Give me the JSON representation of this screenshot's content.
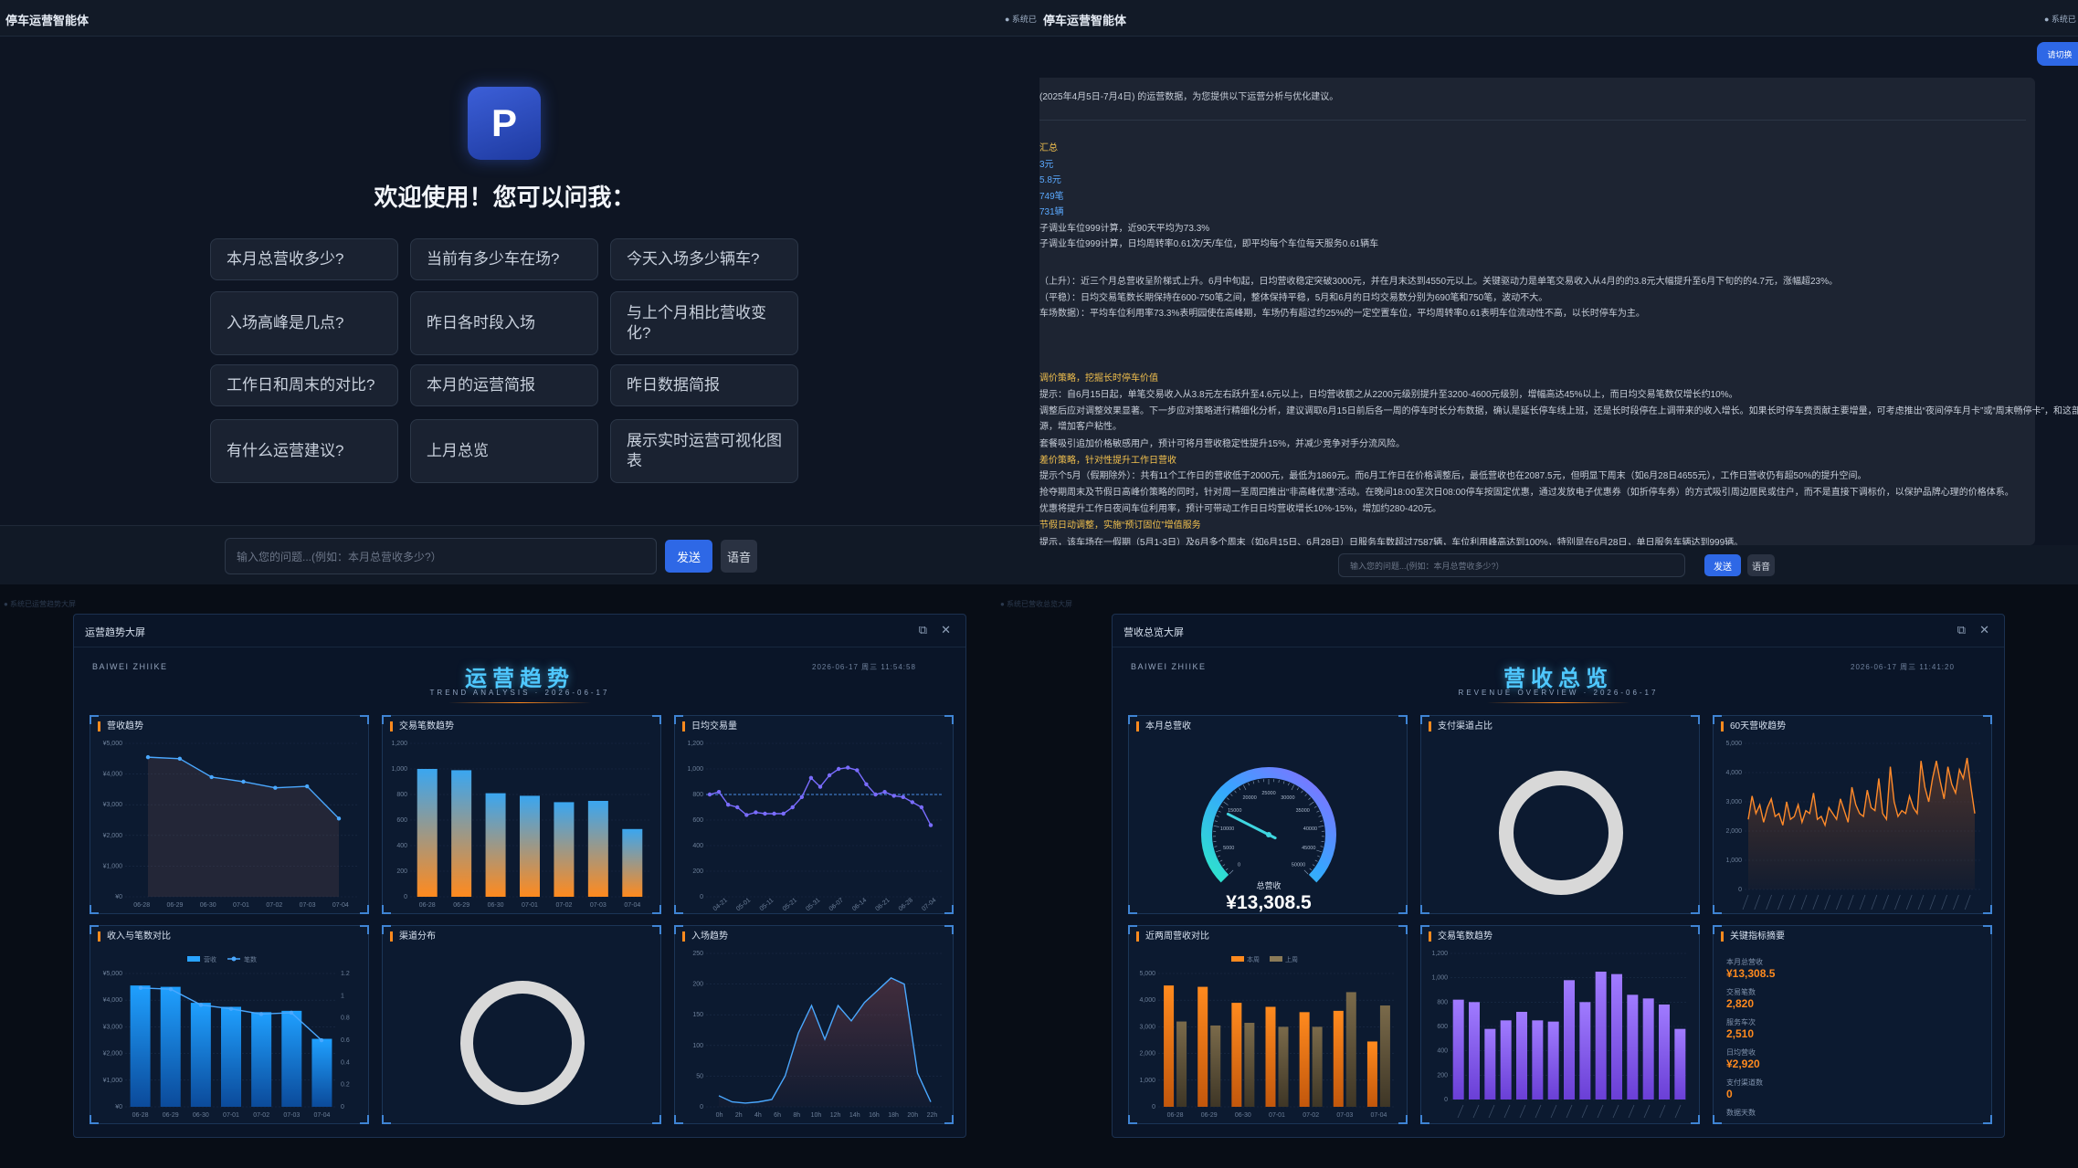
{
  "topbar": {
    "left_title": "停车运营智能体",
    "center_prefix": "● 系统已",
    "center_title": "停车运营智能体",
    "right_prefix": "● 系统已"
  },
  "float_button": "请切换",
  "assistant": {
    "welcome": "欢迎使用！您可以问我：",
    "suggestions": [
      "本月总营收多少?",
      "当前有多少车在场?",
      "今天入场多少辆车?",
      "入场高峰是几点?",
      "昨日各时段入场",
      "与上个月相比营收变化?",
      "工作日和周末的对比?",
      "本月的运营简报",
      "昨日数据简报",
      "有什么运营建议?",
      "上月总览",
      "展示实时运营可视化图表"
    ],
    "input_placeholder": "输入您的问题...(例如：本月总营收多少?）",
    "send_label": "发送",
    "voice_label": "语音"
  },
  "report": {
    "lines": [
      {
        "text": "(2025年4月5日-7月4日) 的运营数据，为您提供以下运营分析与优化建议。",
        "color": "#c6cdd8"
      },
      {
        "text": "汇总",
        "color": "#f2c14e"
      },
      {
        "text": "3元",
        "color": "#5aa9ff"
      },
      {
        "text": "5.8元",
        "color": "#5aa9ff"
      },
      {
        "text": "749笔",
        "color": "#5aa9ff"
      },
      {
        "text": "731辆",
        "color": "#5aa9ff"
      },
      {
        "text": "子调业车位999计算，近90天平均为73.3%",
        "color": "#c6cdd8"
      },
      {
        "text": "子调业车位999计算，日均周转率0.61次/天/车位，即平均每个车位每天服务0.61辆车",
        "color": "#c6cdd8"
      },
      {
        "text": "（上升）：近三个月总营收呈阶梯式上升。6月中旬起，日均营收稳定突破3000元，并在月末达到4550元以上。关键驱动力是单笔交易收入从4月的的3.8元大幅提升至6月下旬的的4.7元，涨幅超23%。",
        "color": "#c6cdd8"
      },
      {
        "text": "（平稳）：日均交易笔数长期保持在600-750笔之间，整体保持平稳，5月和6月的日均交易数分别为690笔和750笔，波动不大。",
        "color": "#c6cdd8"
      },
      {
        "text": "车场数据）：平均车位利用率73.3%表明园使在高峰期，车场仍有超过约25%的一定空置车位，平均周转率0.61表明车位流动性不高，以长时停车为主。",
        "color": "#c6cdd8"
      },
      {
        "text": "调价策略，挖掘长时停车价值",
        "color": "#f2c14e"
      },
      {
        "text": "提示：自6月15日起，单笔交易收入从3.8元左右跃升至4.6元以上，日均营收额之从2200元级别提升至3200-4600元级别，增幅高达45%以上，而日均交易笔数仅增长约10%。",
        "color": "#c6cdd8"
      },
      {
        "text": "调整后应对调整效果显著。下一步应对策略进行精细化分析，建议调取6月15日前后各一周的停车时长分布数据，确认是延长停车线上班，还是长时段停在上调带来的收入增长。如果长时停车费贡献主要增量，可考虑推出“夜间停车月卡”或“周末畅停卡”，和这部分新增的长时客",
        "color": "#c6cdd8"
      },
      {
        "text": "源，增加客户粘性。",
        "color": "#c6cdd8"
      },
      {
        "text": "套餐吸引追加价格敏感用户，预计可将月营收稳定性提升15%，并减少竞争对手分流风险。",
        "color": "#c6cdd8"
      },
      {
        "text": "差价策略，针对性提升工作日营收",
        "color": "#f2c14e"
      },
      {
        "text": "提示个5月（假期除外）：共有11个工作日的营收低于2000元，最低为1869元。而6月工作日在价格调整后，最低营收也在2087.5元，但明显下周末（如6月28日4655元），工作日营收仍有超50%的提升空间。",
        "color": "#c6cdd8"
      },
      {
        "text": "抢夺期周末及节假日高峰价策略的同时，针对周一至周四推出“非高峰优惠”活动。在晚间18:00至次日08:00停车按固定优惠，通过发放电子优惠券（如折停车券）的方式吸引周边居民或住户，而不是直接下调标价，以保护品牌心理的价格体系。",
        "color": "#c6cdd8"
      },
      {
        "text": "优惠将提升工作日夜间车位利用率，预计可带动工作日日均营收增长10%-15%，增加约280-420元。",
        "color": "#c6cdd8"
      },
      {
        "text": "节假日动调整，实施“预订固位”增值服务",
        "color": "#f2c14e"
      },
      {
        "text": "提示，该车场在一假期（5月1-3日）及6月多个周末（如6月15日、6月28日）日服务车数超过7587辆，车位利用峰高达到100%，特别是在6月28日，单日服务车辆达到999辆。",
        "color": "#c6cdd8"
      }
    ],
    "input_placeholder": "输入您的问题...(例如：本月总营收多少?）",
    "send_label": "发送",
    "voice_label": "语音"
  },
  "behind_labels": {
    "left": "● 系统已运营趋势大屏",
    "right": "● 系统已营收总览大屏"
  },
  "dash_ops": {
    "window_title": "运营趋势大屏",
    "brand": "BAIWEI ZHIIKE",
    "title": "运营趋势",
    "subtitle": "TREND ANALYSIS · 2026-06-17",
    "datetime": "2026-06-17  周三  11:54:58",
    "cards": [
      "营收趋势",
      "交易笔数趋势",
      "日均交易量",
      "收入与笔数对比",
      "渠道分布",
      "入场趋势"
    ]
  },
  "dash_rev": {
    "window_title": "营收总览大屏",
    "brand": "BAIWEI ZHIIKE",
    "title": "营收总览",
    "subtitle": "REVENUE OVERVIEW · 2026-06-17",
    "datetime": "2026-06-17  周三  11:41:20",
    "cards": [
      "本月总营收",
      "支付渠道占比",
      "60天营收趋势",
      "近两周营收对比",
      "交易笔数趋势",
      "关键指标摘要"
    ],
    "gauge_label": "总营收",
    "gauge_value": "¥13,308.5",
    "legend_this": "本周",
    "legend_last": "上周",
    "kpis": [
      {
        "label": "本月总营收",
        "value": "¥13,308.5"
      },
      {
        "label": "交易笔数",
        "value": "2,820"
      },
      {
        "label": "服务车次",
        "value": "2,510"
      },
      {
        "label": "日均营收",
        "value": "¥2,920"
      },
      {
        "label": "支付渠道数",
        "value": "0"
      },
      {
        "label": "数据天数",
        "value": ""
      }
    ]
  },
  "chart_data": [
    {
      "type": "area",
      "title": "营收趋势",
      "categories": [
        "06-28",
        "06-29",
        "06-30",
        "07-01",
        "07-02",
        "07-03",
        "07-04"
      ],
      "values": [
        4550,
        4500,
        3900,
        3750,
        3550,
        3600,
        2550
      ],
      "yticks": [
        "¥0",
        "¥1,000",
        "¥2,000",
        "¥3,000",
        "¥4,000",
        "¥5,000"
      ],
      "ylim": [
        0,
        5000
      ]
    },
    {
      "type": "bar",
      "title": "交易笔数趋势",
      "categories": [
        "06-28",
        "06-29",
        "06-30",
        "07-01",
        "07-02",
        "07-03",
        "07-04"
      ],
      "values": [
        1000,
        990,
        810,
        790,
        740,
        750,
        530
      ],
      "yticks": [
        "0",
        "200",
        "400",
        "600",
        "800",
        "1,000",
        "1,200"
      ],
      "ylim": [
        0,
        1200
      ]
    },
    {
      "type": "line",
      "title": "日均交易量",
      "xticks": [
        "04-21",
        "05-01",
        "05-11",
        "05-21",
        "05-31",
        "06-07",
        "06-14",
        "06-21",
        "06-28",
        "07-04"
      ],
      "values": [
        800,
        820,
        720,
        700,
        640,
        660,
        650,
        650,
        650,
        700,
        780,
        930,
        860,
        950,
        1000,
        1010,
        990,
        880,
        800,
        820,
        790,
        780,
        740,
        700,
        560
      ],
      "reference": 800,
      "yticks": [
        "0",
        "200",
        "400",
        "600",
        "800",
        "1,000",
        "1,200"
      ],
      "ylim": [
        0,
        1200
      ]
    },
    {
      "type": "bar",
      "title": "收入与笔数对比",
      "categories": [
        "06-28",
        "06-29",
        "06-30",
        "07-01",
        "07-02",
        "07-03",
        "07-04"
      ],
      "series": [
        {
          "name": "营收",
          "values": [
            4550,
            4500,
            3900,
            3750,
            3550,
            3600,
            2550
          ]
        },
        {
          "name": "笔数",
          "values": [
            1000,
            990,
            810,
            790,
            740,
            750,
            530
          ]
        }
      ],
      "yticks": [
        "¥0",
        "¥1,000",
        "¥2,000",
        "¥3,000",
        "¥4,000",
        "¥5,000"
      ],
      "y2ticks": [
        "0",
        "0.2",
        "0.4",
        "0.6",
        "0.8",
        "1",
        "1.2"
      ],
      "ylim": [
        0,
        5000
      ]
    },
    {
      "type": "pie",
      "title": "渠道分布",
      "values": [
        1
      ]
    },
    {
      "type": "area",
      "title": "入场趋势",
      "xticks": [
        "0h",
        "2h",
        "4h",
        "6h",
        "8h",
        "10h",
        "12h",
        "14h",
        "16h",
        "18h",
        "20h",
        "22h"
      ],
      "values": [
        18,
        8,
        6,
        8,
        12,
        50,
        120,
        165,
        110,
        165,
        140,
        170,
        190,
        210,
        200,
        55,
        8
      ],
      "yticks": [
        "0",
        "50",
        "100",
        "150",
        "200",
        "250"
      ],
      "ylim": [
        0,
        250
      ]
    },
    {
      "type": "gauge",
      "title": "本月总营收",
      "value": 13308.5,
      "max": 50000,
      "ticks": [
        "0",
        "5000",
        "10000",
        "15000",
        "20000",
        "25000",
        "30000",
        "35000",
        "40000",
        "45000",
        "50000"
      ]
    },
    {
      "type": "pie",
      "title": "支付渠道占比",
      "values": [
        1
      ]
    },
    {
      "type": "area",
      "title": "60天营收趋势",
      "values": [
        2400,
        3200,
        2600,
        2900,
        2300,
        2800,
        3100,
        2500,
        2600,
        2200,
        3000,
        2400,
        2500,
        2900,
        2300,
        2700,
        2600,
        3300,
        2400,
        2500,
        2200,
        2800,
        2600,
        2400,
        3100,
        2700,
        2300,
        3500,
        2900,
        2600,
        2500,
        3400,
        2800,
        2700,
        3800,
        2600,
        2400,
        4200,
        3000,
        2500,
        2700,
        2600,
        3200,
        2800,
        2600,
        4400,
        3500,
        3000,
        3800,
        4400,
        3700,
        3100,
        4200,
        3600,
        3300,
        4100,
        3800,
        4500,
        3500,
        2600
      ],
      "yticks": [
        "0",
        "1,000",
        "2,000",
        "3,000",
        "4,000",
        "5,000"
      ],
      "ylim": [
        0,
        5000
      ]
    },
    {
      "type": "bar",
      "title": "近两周营收对比",
      "categories": [
        "06-28",
        "06-29",
        "06-30",
        "07-01",
        "07-02",
        "07-03",
        "07-04"
      ],
      "series": [
        {
          "name": "本周",
          "values": [
            4550,
            4500,
            3900,
            3750,
            3550,
            3600,
            2450
          ]
        },
        {
          "name": "上周",
          "values": [
            3200,
            3050,
            3150,
            3000,
            3000,
            4300,
            3800
          ]
        }
      ],
      "yticks": [
        "0",
        "1,000",
        "2,000",
        "3,000",
        "4,000",
        "5,000"
      ],
      "ylim": [
        0,
        5000
      ]
    },
    {
      "type": "bar",
      "title": "交易笔数趋势",
      "values": [
        820,
        800,
        580,
        650,
        720,
        650,
        640,
        980,
        800,
        1050,
        1030,
        860,
        830,
        780,
        580
      ],
      "yticks": [
        "0",
        "200",
        "400",
        "600",
        "800",
        "1,000",
        "1,200"
      ],
      "ylim": [
        0,
        1200
      ]
    }
  ],
  "colors": {
    "accent": "#4fc8ff",
    "orange": "#ff8a1e",
    "purple": "#9d6bff",
    "blue_btn": "#2e68e6"
  }
}
